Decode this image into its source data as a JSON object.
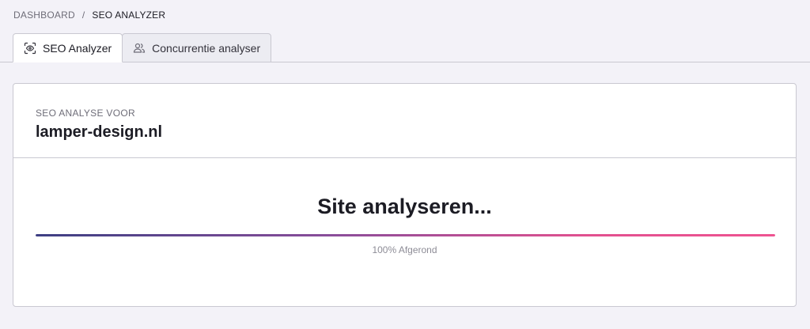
{
  "breadcrumb": {
    "items": [
      "DASHBOARD",
      "SEO ANALYZER"
    ],
    "separator": "/"
  },
  "tabs": [
    {
      "label": "SEO Analyzer",
      "icon": "scan-eye-icon",
      "active": true
    },
    {
      "label": "Concurrentie analyser",
      "icon": "users-icon",
      "active": false
    }
  ],
  "card": {
    "label": "SEO ANALYSE VOOR",
    "domain": "lamper-design.nl"
  },
  "analysis": {
    "status": "Site analyseren...",
    "progress_percent": 100,
    "progress_text": "100% Afgerond",
    "gradient_colors": [
      "#3d3f83",
      "#ee5391"
    ]
  }
}
